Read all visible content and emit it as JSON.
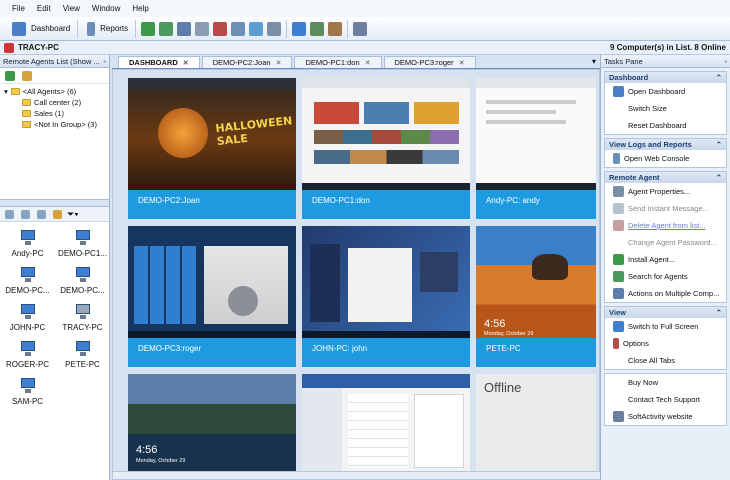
{
  "menu": [
    "File",
    "Edit",
    "View",
    "Window",
    "Help"
  ],
  "toolbar": {
    "dashboard_label": "Dashboard",
    "reports_label": "Reports"
  },
  "title": {
    "computer": "TRACY-PC",
    "status": "9 Computer(s) in List. 8 Online"
  },
  "left_panel": {
    "title": "Remote Agents List (Show ...",
    "tree": [
      {
        "label": "<All Agents> (6)"
      },
      {
        "label": "Call center (2)"
      },
      {
        "label": "Sales (1)"
      },
      {
        "label": "<Not In Group> (3)"
      }
    ],
    "computers": [
      "Andy-PC",
      "DEMO-PC1...",
      "DEMO-PC...",
      "DEMO-PC...",
      "JOHN-PC",
      "TRACY-PC",
      "ROGER-PC",
      "PETE-PC",
      "SAM-PC"
    ]
  },
  "tabs": [
    {
      "label": "DASHBOARD"
    },
    {
      "label": "DEMO-PC2:Joan"
    },
    {
      "label": "DEMO-PC1:don"
    },
    {
      "label": "DEMO-PC3:roger"
    }
  ],
  "thumbnails": [
    {
      "label": "DEMO-PC2:Joan",
      "banner": "HALLOWEEN SALE"
    },
    {
      "label": "DEMO-PC1:don"
    },
    {
      "label": "Andy-PC: andy"
    },
    {
      "label": "DEMO-PC3:roger"
    },
    {
      "label": "JOHN-PC: john"
    },
    {
      "label": "PETE-PC",
      "time": "4:56",
      "date": "Monday, October 29"
    },
    {
      "label": "",
      "time": "4:56",
      "date": "Monday, October 29"
    },
    {
      "label": ""
    },
    {
      "label": "",
      "offline": "Offline"
    }
  ],
  "tasks_pane": {
    "title": "Tasks Pane",
    "groups": [
      {
        "title": "Dashboard",
        "items": [
          "Open Dashboard",
          "Switch Size",
          "Reset Dashboard"
        ]
      },
      {
        "title": "View Logs and Reports",
        "items": [
          "Open Web Console"
        ]
      },
      {
        "title": "Remote Agent",
        "items": [
          "Agent Properties...",
          "Send Instant Message...",
          "Delete Agent from list...",
          "Change Agent Password...",
          "Install Agent...",
          "Search for Agents",
          "Actions on Multiple Comp..."
        ]
      },
      {
        "title": "View",
        "items": [
          "Switch to Full Screen",
          "Options",
          "Close All Tabs"
        ]
      },
      {
        "title": "",
        "items": [
          "Buy Now",
          "Contact Tech Support",
          "SoftActivity website"
        ]
      }
    ]
  },
  "colors": {
    "accent": "#1e9be0",
    "header": "#1d3f72"
  }
}
